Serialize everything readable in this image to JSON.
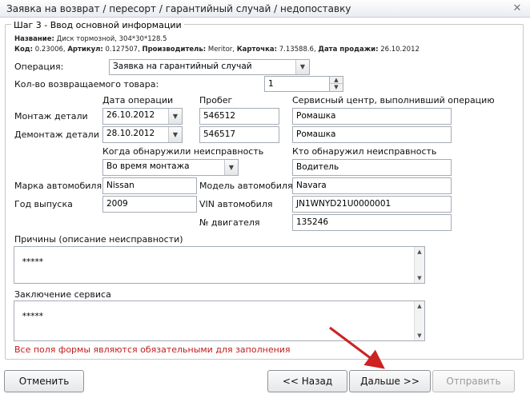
{
  "window": {
    "title": "Заявка на возврат / пересорт / гарантийный случай / недопоставку",
    "close_glyph": "✕"
  },
  "step": {
    "legend": "Шаг 3 - Ввод основной информации"
  },
  "info": {
    "name_label": "Название:",
    "name_value": "Диск тормозной, 304*30*128.5",
    "code_label": "Код:",
    "code_value": "0.23006,",
    "article_label": "Артикул:",
    "article_value": "0.127507,",
    "manufacturer_label": "Производитель:",
    "manufacturer_value": "Meritor,",
    "card_label": "Карточка:",
    "card_value": "7.13588.6,",
    "sale_date_label": "Дата продажи:",
    "sale_date_value": "26.10.2012"
  },
  "form": {
    "operation_label": "Операция:",
    "operation_value": "Заявка на гарантийный случай",
    "qty_label": "Кол-во возвращаемого товара:",
    "qty_value": "1",
    "col_op_date": "Дата операции",
    "col_mileage": "Пробег",
    "col_service": "Сервисный центр, выполнивший операцию",
    "mount_label": "Монтаж детали",
    "mount_date": "26.10.2012",
    "mount_mileage": "546512",
    "mount_service": "Ромашка",
    "dismount_label": "Демонтаж детали",
    "dismount_date": "28.10.2012",
    "dismount_mileage": "546517",
    "dismount_service": "Ромашка",
    "when_found_label": "Когда обнаружили неисправность",
    "when_found_value": "Во время монтажа",
    "who_found_label": "Кто обнаружил неисправность",
    "who_found_value": "Водитель",
    "car_brand_label": "Марка автомобиля",
    "car_brand_value": "Nissan",
    "car_model_label": "Модель автомобиля",
    "car_model_value": "Navara",
    "year_label": "Год выпуска",
    "year_value": "2009",
    "vin_label": "VIN автомобиля",
    "vin_value": "JN1WNYD21U0000001",
    "engine_label": "№ двигателя",
    "engine_value": "135246",
    "reasons_label": "Причины (описание неисправности)",
    "reasons_value": "*****",
    "conclusion_label": "Заключение сервиса",
    "conclusion_value": "*****",
    "required_note": "Все поля формы являются обязательными для заполнения"
  },
  "buttons": {
    "cancel": "Отменить",
    "back": "<< Назад",
    "next": "Дальше >>",
    "send": "Отправить"
  },
  "colors": {
    "required_note": "#c41b1b",
    "annotation_arrow": "#cc2222"
  },
  "icons": {
    "dropdown": "▼",
    "spin_up": "▲",
    "spin_down": "▼",
    "scroll_up": "▲",
    "scroll_down": "▼"
  }
}
